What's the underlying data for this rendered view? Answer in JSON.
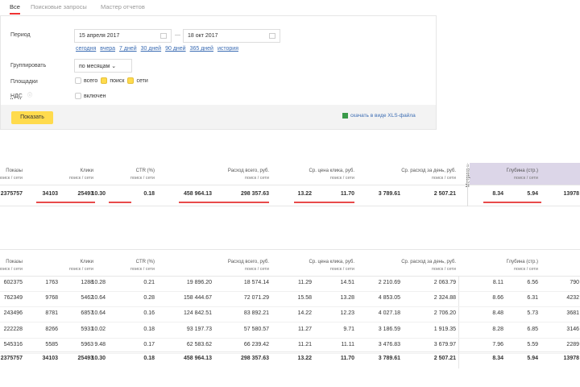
{
  "tabs": [
    "Все",
    "Поисковые запросы",
    "Мастер отчетов"
  ],
  "form": {
    "period_label": "Период",
    "date_from": "15 апреля 2017",
    "date_to": "18 окт 2017",
    "dash": "—",
    "quick_links": [
      "сегодня",
      "вчера",
      "7 дней",
      "30 дней",
      "90 дней",
      "365 дней",
      "история"
    ],
    "group_label": "Группировать",
    "group_value": "по месяцам",
    "places_label": "Площадки",
    "places": [
      {
        "label": "всего",
        "checked": false
      },
      {
        "label": "поиск",
        "checked": true
      },
      {
        "label": "сети",
        "checked": true
      }
    ],
    "vat_label": "НДС",
    "vat_option": "включен",
    "show_button": "Показать",
    "xls_link": "скачать в виде XLS-файла"
  },
  "headers": {
    "impressions": "Показы",
    "clicks": "Клики",
    "ctr": "CTR (%)",
    "spend": "Расход всего, руб.",
    "cpc": "Ср. цена клика, руб.",
    "daily": "Ср. расход за день, руб.",
    "depth": "Глубина (стр.)",
    "sub": "поиск / сети",
    "metrika": "Метрика »"
  },
  "summary": {
    "impressions": "2375757",
    "clicks": [
      "34103",
      "25493"
    ],
    "ctr": [
      "10.30",
      "0.18"
    ],
    "spend": [
      "458 964.13",
      "298 357.63"
    ],
    "cpc": [
      "13.22",
      "11.70"
    ],
    "daily": [
      "3 789.61",
      "2 507.21"
    ],
    "depth": [
      "8.34",
      "5.94"
    ],
    "last": "13978"
  },
  "rows": [
    {
      "impressions": "602375",
      "clicks": [
        "1763",
        "1288"
      ],
      "ctr": [
        "10.28",
        "0.21"
      ],
      "spend": [
        "19 896.20",
        "18 574.14"
      ],
      "cpc": [
        "11.29",
        "14.51"
      ],
      "daily": [
        "2 210.69",
        "2 063.79"
      ],
      "depth": [
        "8.11",
        "6.56"
      ],
      "last": "790"
    },
    {
      "impressions": "762349",
      "clicks": [
        "9768",
        "5462"
      ],
      "ctr": [
        "10.64",
        "0.28"
      ],
      "spend": [
        "158 444.67",
        "72 071.29"
      ],
      "cpc": [
        "15.58",
        "13.28"
      ],
      "daily": [
        "4 853.05",
        "2 324.88"
      ],
      "depth": [
        "8.66",
        "6.31"
      ],
      "last": "4232"
    },
    {
      "impressions": "243496",
      "clicks": [
        "8781",
        "6857"
      ],
      "ctr": [
        "10.64",
        "0.16"
      ],
      "spend": [
        "124 842.51",
        "83 892.21"
      ],
      "cpc": [
        "14.22",
        "12.23"
      ],
      "daily": [
        "4 027.18",
        "2 706.20"
      ],
      "depth": [
        "8.48",
        "5.73"
      ],
      "last": "3681"
    },
    {
      "impressions": "222228",
      "clicks": [
        "8266",
        "5931"
      ],
      "ctr": [
        "10.02",
        "0.18"
      ],
      "spend": [
        "93 197.73",
        "57 580.57"
      ],
      "cpc": [
        "11.27",
        "9.71"
      ],
      "daily": [
        "3 186.59",
        "1 919.35"
      ],
      "depth": [
        "8.28",
        "6.85"
      ],
      "last": "3146"
    },
    {
      "impressions": "545316",
      "clicks": [
        "5585",
        "5963"
      ],
      "ctr": [
        "9.48",
        "0.17"
      ],
      "spend": [
        "62 583.62",
        "66 239.42"
      ],
      "cpc": [
        "11.21",
        "11.11"
      ],
      "daily": [
        "3 476.83",
        "3 679.97"
      ],
      "depth": [
        "7.96",
        "5.59"
      ],
      "last": "2289"
    }
  ],
  "total": {
    "impressions": "2375757",
    "clicks": [
      "34103",
      "25493"
    ],
    "ctr": [
      "10.30",
      "0.18"
    ],
    "spend": [
      "458 964.13",
      "298 357.63"
    ],
    "cpc": [
      "13.22",
      "11.70"
    ],
    "daily": [
      "3 789.61",
      "2 507.21"
    ],
    "depth": [
      "8.34",
      "5.94"
    ],
    "last": "13978"
  },
  "colors": {
    "accent": "#ffdb4d",
    "underline": "#e84a4a",
    "metrika_bg": "#dcd6e8"
  }
}
